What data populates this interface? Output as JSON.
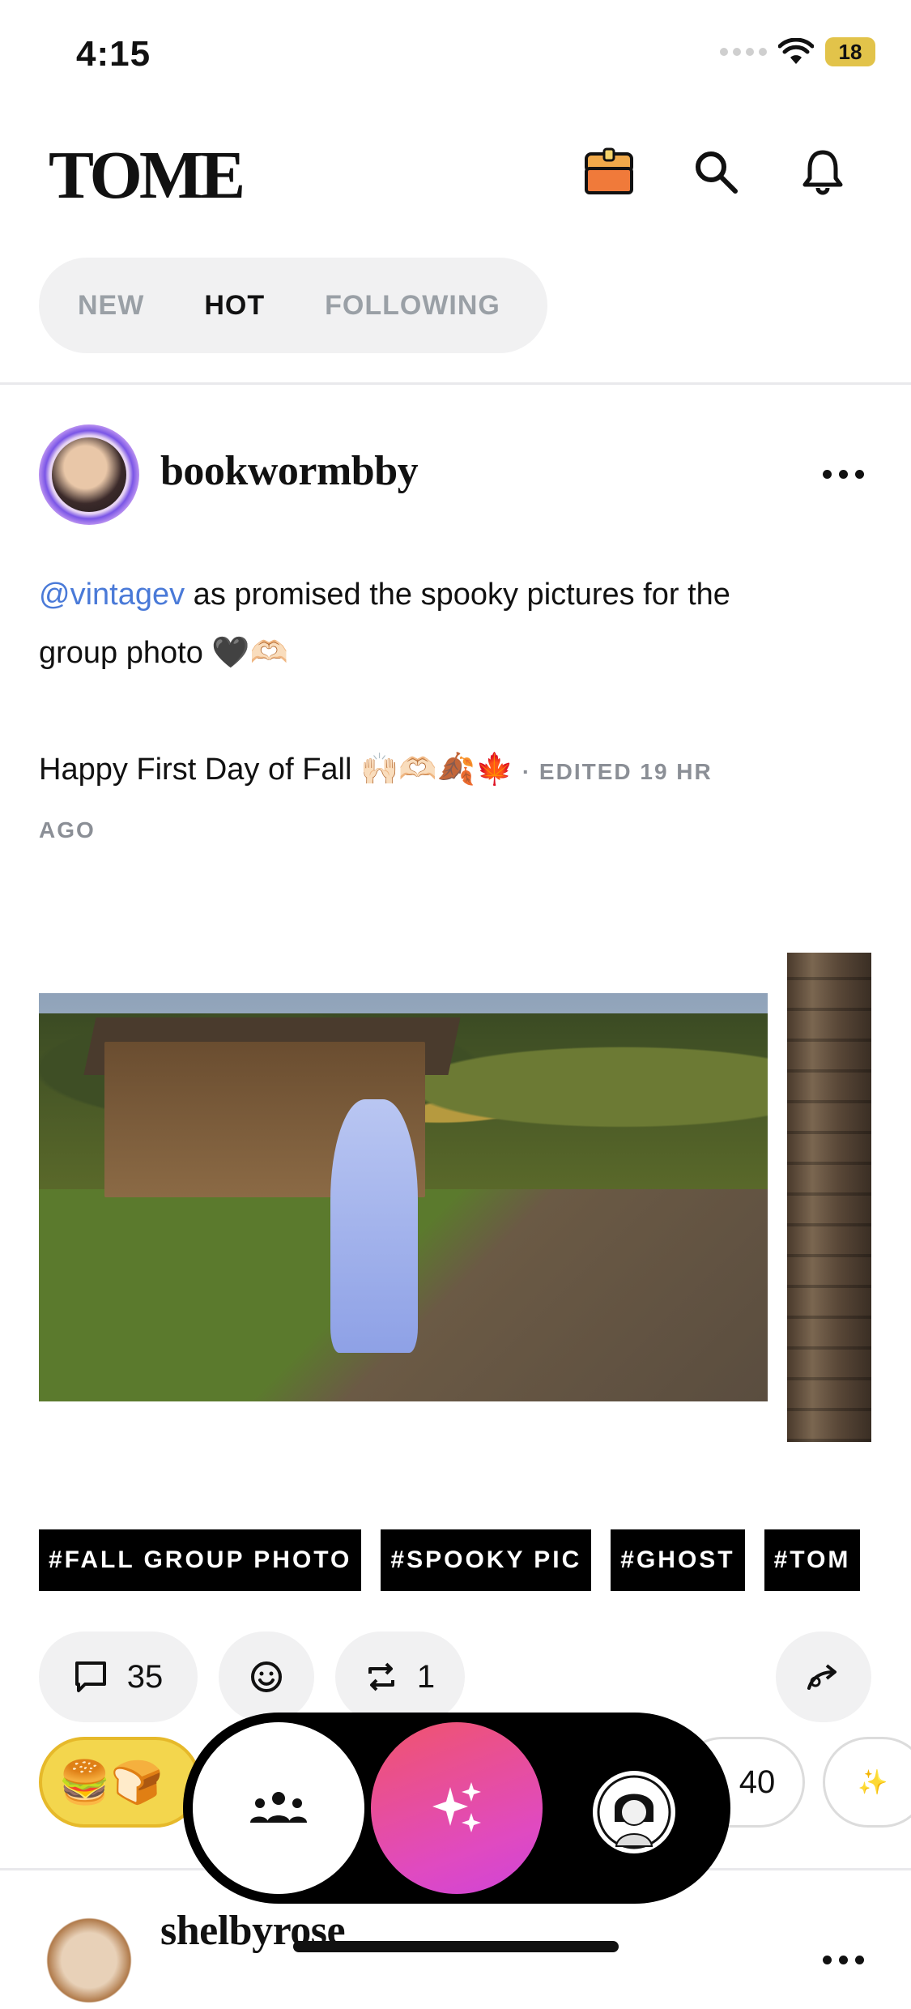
{
  "status_bar": {
    "time": "4:15",
    "battery": "18"
  },
  "header": {
    "logo": "TOME"
  },
  "tabs": [
    {
      "label": "NEW",
      "active": false
    },
    {
      "label": "HOT",
      "active": true
    },
    {
      "label": "FOLLOWING",
      "active": false
    }
  ],
  "post": {
    "username": "bookwormbby",
    "mention": "@vintagev",
    "line1_rest": " as promised the spooky pictures for the",
    "line2": "group photo 🖤🫶🏻",
    "line3": "Happy First Day of Fall 🙌🏻🫶🏻🍂🍁",
    "edited": "· EDITED 19 HR",
    "ago": "AGO",
    "tags": [
      "#FALL GROUP PHOTO",
      "#SPOOKY PIC",
      "#GHOST",
      "#TOM"
    ],
    "comments": "35",
    "reposts": "1"
  },
  "reactions": {
    "emoji_pair": "🍔🍞",
    "count": "40",
    "partial_emoji": "✨"
  },
  "next_post": {
    "username": "shelbyrose"
  },
  "colors": {
    "accent_pink": "#e04ac0",
    "mention_blue": "#4a7ad8"
  }
}
